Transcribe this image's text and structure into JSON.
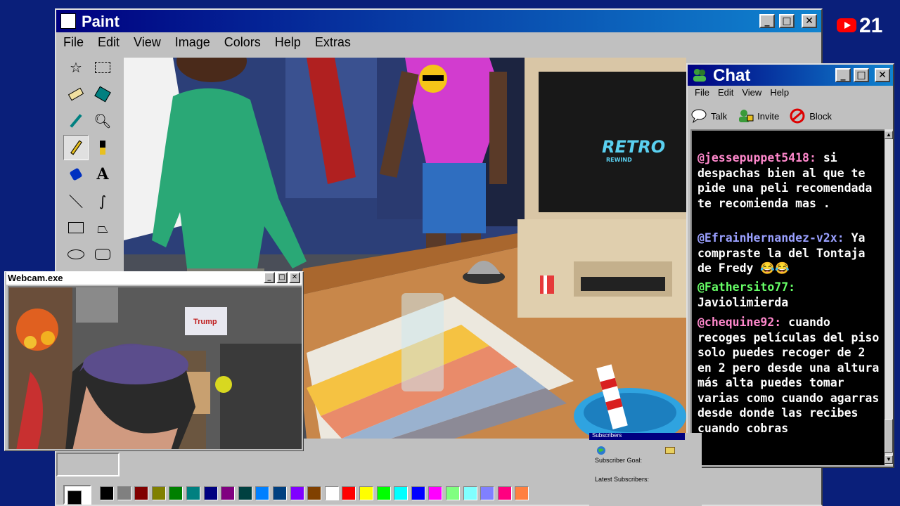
{
  "paint": {
    "title": "Paint",
    "menu": [
      "File",
      "Edit",
      "View",
      "Image",
      "Colors",
      "Help",
      "Extras"
    ],
    "tools": [
      "free-select",
      "rect-select",
      "eraser",
      "fill",
      "color-picker",
      "magnifier",
      "pencil",
      "brush",
      "airbrush",
      "text",
      "line",
      "curve",
      "rectangle",
      "polygon",
      "ellipse",
      "rounded-rect"
    ],
    "palette": [
      "#000000",
      "#808080",
      "#800000",
      "#808000",
      "#008000",
      "#008080",
      "#000080",
      "#800080",
      "#004040",
      "#0080ff",
      "#004080",
      "#8000ff",
      "#804000",
      "#ffffff",
      "#ff0000",
      "#ffff00",
      "#00ff00",
      "#00ffff",
      "#0000ff",
      "#ff00ff",
      "#80ff80",
      "#80ffff",
      "#8080ff",
      "#ff0080",
      "#ff8040"
    ],
    "canvas": {
      "screen_logo_line1": "RETRO",
      "screen_logo_line2": "REWIND"
    }
  },
  "counter": {
    "value": "21"
  },
  "chat": {
    "title": "Chat",
    "menu": [
      "File",
      "Edit",
      "View",
      "Help"
    ],
    "toolbar": [
      {
        "label": "Talk",
        "icon": "talk-icon"
      },
      {
        "label": "Invite",
        "icon": "invite-icon"
      },
      {
        "label": "Block",
        "icon": "block-icon"
      }
    ],
    "messages": [
      {
        "user": "@jessepuppet5418:",
        "text": "si despachas bien al que te pide una peli recomendada te recomienda mas .",
        "color": "#ff88cc"
      },
      {
        "user": "@EfrainHernandez-v2x:",
        "text": "Ya compraste la del Tontaja de Fredy 😂😂",
        "color": "#9aa0ff"
      },
      {
        "user": "@Fathersito77:",
        "text": "Javiolimierda",
        "color": "#66ff66"
      },
      {
        "user": "@chequine92:",
        "text": "cuando recoges películas del piso solo puedes recoger de 2 en 2 pero desde una altura más alta puedes tomar varias como cuando agarras desde donde las recibes cuando cobras",
        "color": "#ff88cc"
      }
    ]
  },
  "webcam": {
    "title": "Webcam.exe",
    "poster_text": "Trump"
  },
  "subscribers": {
    "title": "Subscribers",
    "goal_label": "Subscriber Goal:",
    "latest_label": "Latest Subscribers:"
  }
}
